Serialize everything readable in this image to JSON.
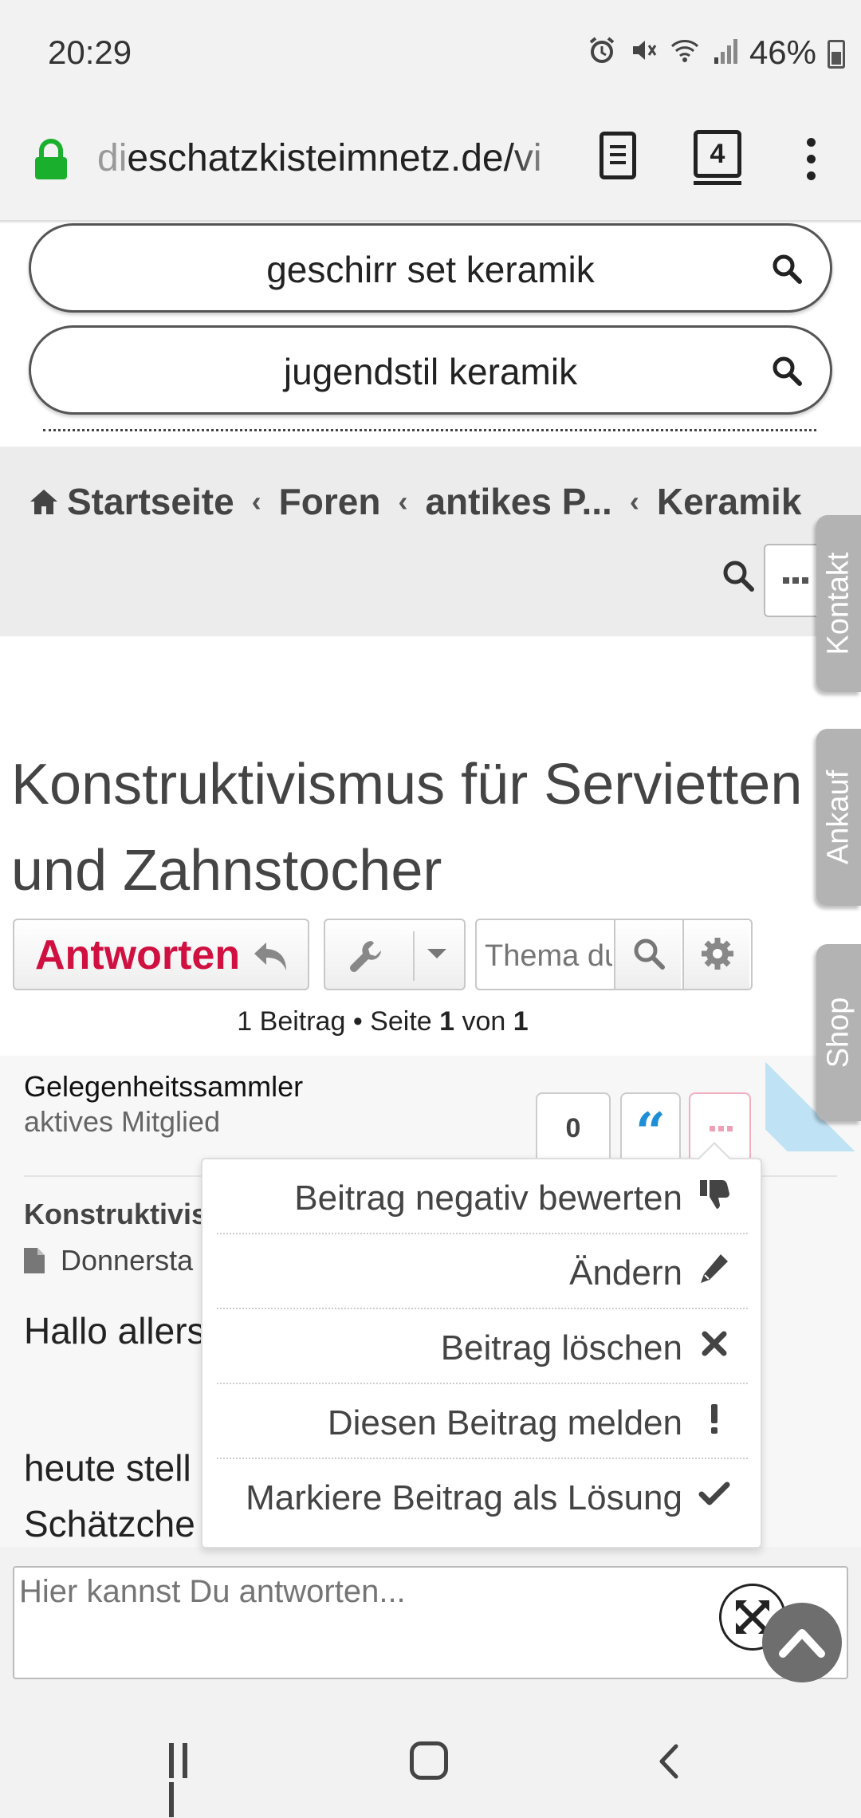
{
  "status": {
    "time": "20:29",
    "battery": "46%"
  },
  "browser": {
    "url_dim": "di",
    "url_main": "eschatzkisteimnetz.de/vi",
    "tab_count": "4"
  },
  "searches": [
    {
      "label": "geschirr set keramik"
    },
    {
      "label": "jugendstil keramik"
    }
  ],
  "breadcrumbs": [
    {
      "label": "Startseite"
    },
    {
      "label": "Foren"
    },
    {
      "label": "antikes P..."
    },
    {
      "label": "Keramik"
    }
  ],
  "breadcrumb_sep": "‹",
  "topic": {
    "title": "Konstruktivismus für Servietten und Zahnstocher"
  },
  "toolbar": {
    "reply_label": "Antworten",
    "search_placeholder": "Thema du"
  },
  "pagination": {
    "prefix": "1 Beitrag • Seite",
    "page": "1",
    "of": "von",
    "total": "1"
  },
  "post": {
    "author": "Gelegenheitssammler",
    "rank": "aktives Mitglied",
    "votes": "0",
    "subject": "Konstruktivis",
    "date": "Donnersta",
    "line1": "Hallo allers",
    "line2": "heute stell",
    "line3": "Schätzche"
  },
  "menu": [
    {
      "label": "Beitrag negativ bewerten",
      "icon": "thumbs-down-icon"
    },
    {
      "label": "Ändern",
      "icon": "pencil-icon"
    },
    {
      "label": "Beitrag löschen",
      "icon": "times-icon"
    },
    {
      "label": "Diesen Beitrag melden",
      "icon": "exclamation-icon"
    },
    {
      "label": "Markiere Beitrag als Lösung",
      "icon": "check-icon"
    }
  ],
  "side_tabs": [
    {
      "label": "Kontakt"
    },
    {
      "label": "Ankauf"
    },
    {
      "label": "Shop"
    }
  ],
  "reply": {
    "placeholder": "Hier kannst Du antworten..."
  },
  "colors": {
    "accent_red": "#d01040",
    "quote_blue": "#1e8fd6",
    "side_tab_gray": "#b3b3b3"
  }
}
